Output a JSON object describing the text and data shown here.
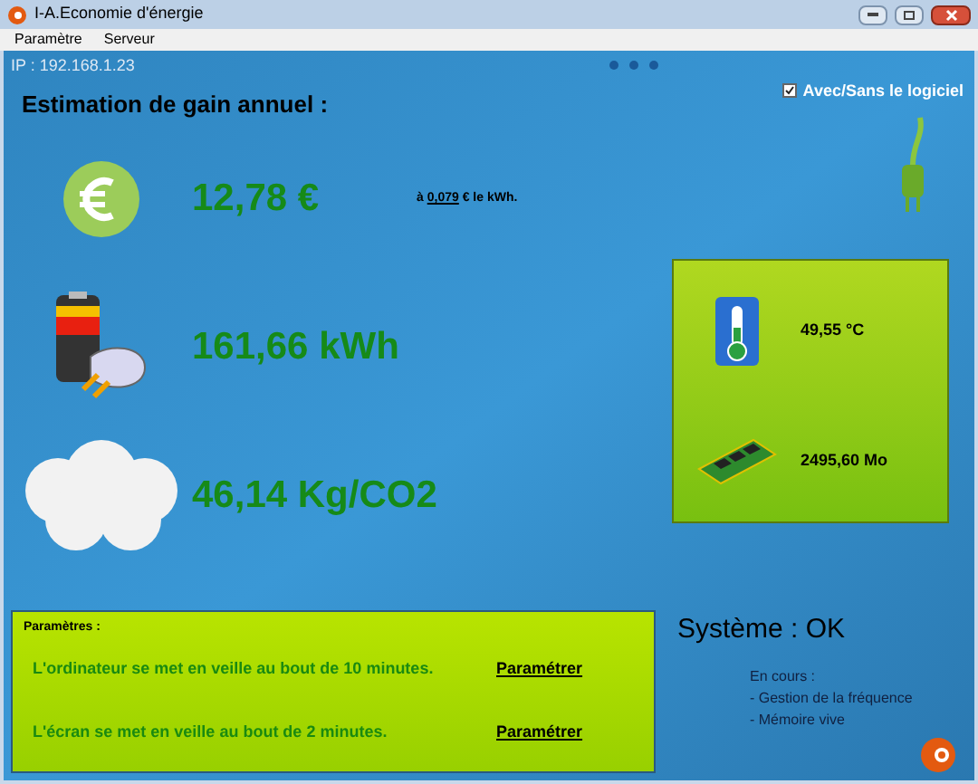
{
  "window": {
    "title": "I-A.Economie d'énergie"
  },
  "menu": [
    "Paramètre",
    "Serveur"
  ],
  "ip": "IP : 192.168.1.23",
  "toggle": {
    "label": "Avec/Sans le logiciel",
    "checked": true
  },
  "heading": "Estimation de gain annuel :",
  "metrics": [
    {
      "kind": "money",
      "value": "12,78 €"
    },
    {
      "kind": "energy",
      "value": "161,66 kWh"
    },
    {
      "kind": "co2",
      "value": "46,14 Kg/CO2"
    }
  ],
  "rate": {
    "prefix": "à",
    "value": "0,079",
    "suffix": "€  le kWh."
  },
  "system_panel": [
    {
      "kind": "temperature",
      "value": "49,55 °C"
    },
    {
      "kind": "memory",
      "value": "2495,60 Mo"
    }
  ],
  "params": {
    "title": "Paramètres :",
    "rows": [
      {
        "text": "L'ordinateur se met en veille au bout de 10 minutes.",
        "action": "Paramétrer"
      },
      {
        "text": "L'écran se met en veille au bout de 2 minutes.",
        "action": "Paramétrer"
      }
    ]
  },
  "status": {
    "title": "Système : OK",
    "label": "En cours :",
    "items": [
      "- Gestion de la fréquence",
      "- Mémoire vive"
    ]
  }
}
